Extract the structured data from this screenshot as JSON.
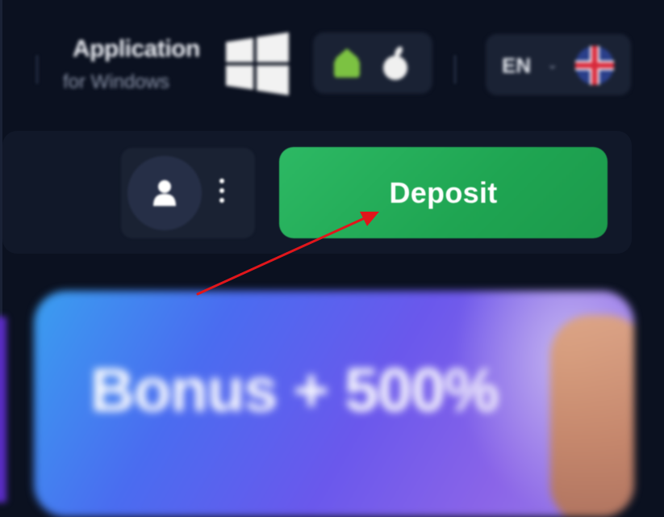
{
  "top_bar": {
    "app_promo": {
      "line1": "Application",
      "line2": "for Windows",
      "icon": "windows-icon"
    },
    "store_icons": [
      "android-icon",
      "apple-icon"
    ],
    "language": {
      "code": "EN",
      "chevron": "⌄",
      "flag_icon": "uk-flag-icon"
    }
  },
  "header": {
    "user_icon": "user-icon",
    "menu_icon": "more-vertical-icon",
    "deposit_label": "Deposit"
  },
  "banner": {
    "title": "Bonus + 500%"
  },
  "annotation": {
    "color": "#e0161b",
    "type": "arrow-pointing-to-deposit-button"
  },
  "colors": {
    "background": "#0b1120",
    "deposit_green": "#22ad57",
    "panel": "#1a2234"
  }
}
